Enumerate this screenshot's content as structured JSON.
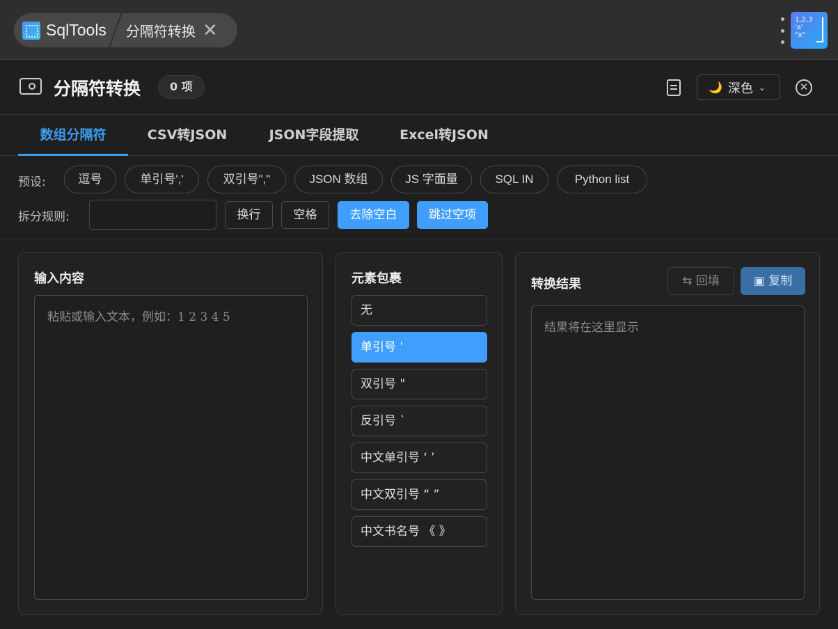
{
  "topbar": {
    "app_name": "SqlTools",
    "page_tab": "分隔符转换",
    "close_glyph": "✕",
    "logo_text": "1,2,3\n'a'\n\"x\""
  },
  "header": {
    "title": "分隔符转换",
    "count": "0 项",
    "theme_label": "深色",
    "theme_icon": "🌙",
    "chev": "⌄",
    "close_glyph": "✕"
  },
  "tabs": [
    {
      "label": "数组分隔符",
      "active": true
    },
    {
      "label": "CSV转JSON",
      "active": false
    },
    {
      "label": "JSON字段提取",
      "active": false
    },
    {
      "label": "Excel转JSON",
      "active": false
    }
  ],
  "presets": {
    "label": "预设:",
    "items": [
      "逗号",
      "单引号','",
      "双引号\",\"",
      "JSON 数组",
      "JS 字面量",
      "SQL IN",
      "Python list"
    ]
  },
  "split_rules": {
    "label": "拆分规则:",
    "input_value": "",
    "buttons": [
      {
        "label": "换行",
        "on": false
      },
      {
        "label": "空格",
        "on": false
      },
      {
        "label": "去除空白",
        "on": true
      },
      {
        "label": "跳过空项",
        "on": true
      }
    ]
  },
  "input_card": {
    "title": "输入内容",
    "placeholder": "粘贴或输入文本，例如：1 2 3 4 5"
  },
  "wrap_card": {
    "title": "元素包裹",
    "options": [
      {
        "label": "无",
        "on": false
      },
      {
        "label": "单引号 '",
        "on": true
      },
      {
        "label": "双引号 \"",
        "on": false
      },
      {
        "label": "反引号 `",
        "on": false
      },
      {
        "label": "中文单引号 ‘ ’",
        "on": false
      },
      {
        "label": "中文双引号 “ ”",
        "on": false
      },
      {
        "label": "中文书名号 《 》",
        "on": false
      }
    ]
  },
  "result_card": {
    "title": "转换结果",
    "refill_label": "回填",
    "copy_label": "复制",
    "refill_icon": "⇆",
    "copy_icon": "▣",
    "placeholder": "结果将在这里显示"
  },
  "colors": {
    "accent": "#409eff",
    "tab_active": "#3d9bf0",
    "background": "#1f1f1f"
  }
}
